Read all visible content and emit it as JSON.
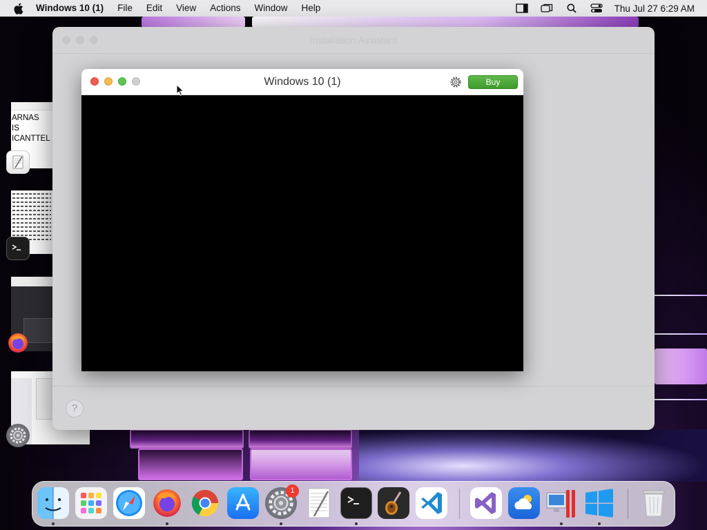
{
  "menubar": {
    "app_name": "Windows 10 (1)",
    "menus": [
      "File",
      "Edit",
      "View",
      "Actions",
      "Window",
      "Help"
    ],
    "clock": "Thu Jul 27  6:29 AM",
    "status_icons": [
      "stage-manager-icon",
      "screen-mirroring-icon",
      "spotlight-search-icon",
      "control-center-icon"
    ]
  },
  "stage_manager": {
    "document_preview_lines": [
      "ARNAS",
      "IS",
      "ICANTTEL"
    ],
    "apps": [
      "textedit-icon",
      "terminal-icon",
      "firefox-icon",
      "system-settings-icon"
    ]
  },
  "assistant_window": {
    "title": "Installation Assistant",
    "help_label": "?"
  },
  "vm_window": {
    "title": "Windows 10 (1)",
    "buy_label": "Buy"
  },
  "dock": {
    "apps": [
      {
        "name": "Finder",
        "icon": "finder-icon",
        "running": true
      },
      {
        "name": "Launchpad",
        "icon": "launchpad-icon",
        "running": false
      },
      {
        "name": "Safari",
        "icon": "safari-icon",
        "running": false
      },
      {
        "name": "Firefox",
        "icon": "firefox-icon",
        "running": true
      },
      {
        "name": "Google Chrome",
        "icon": "chrome-icon",
        "running": false
      },
      {
        "name": "App Store",
        "icon": "app-store-icon",
        "running": false
      },
      {
        "name": "System Settings",
        "icon": "system-settings-icon",
        "running": true,
        "badge": "1"
      },
      {
        "name": "TextEdit",
        "icon": "textedit-icon",
        "running": false
      },
      {
        "name": "Terminal",
        "icon": "terminal-icon",
        "running": true
      },
      {
        "name": "GarageBand",
        "icon": "garageband-icon",
        "running": false
      },
      {
        "name": "Visual Studio Code",
        "icon": "vscode-icon",
        "running": false
      },
      {
        "name": "Visual Studio",
        "icon": "visual-studio-icon",
        "running": false
      },
      {
        "name": "Weather",
        "icon": "weather-icon",
        "running": false
      },
      {
        "name": "Parallels Desktop",
        "icon": "parallels-icon",
        "running": true
      },
      {
        "name": "Windows 10 (1)",
        "icon": "windows-icon",
        "running": true
      },
      {
        "name": "Trash",
        "icon": "trash-icon",
        "running": false
      }
    ]
  },
  "colors": {
    "buy_green": "#4caf38",
    "close_red": "#ee5c56",
    "minimize_yellow": "#f5bd4f",
    "maximize_green": "#5ec454",
    "badge_red": "#ee3a2f"
  }
}
